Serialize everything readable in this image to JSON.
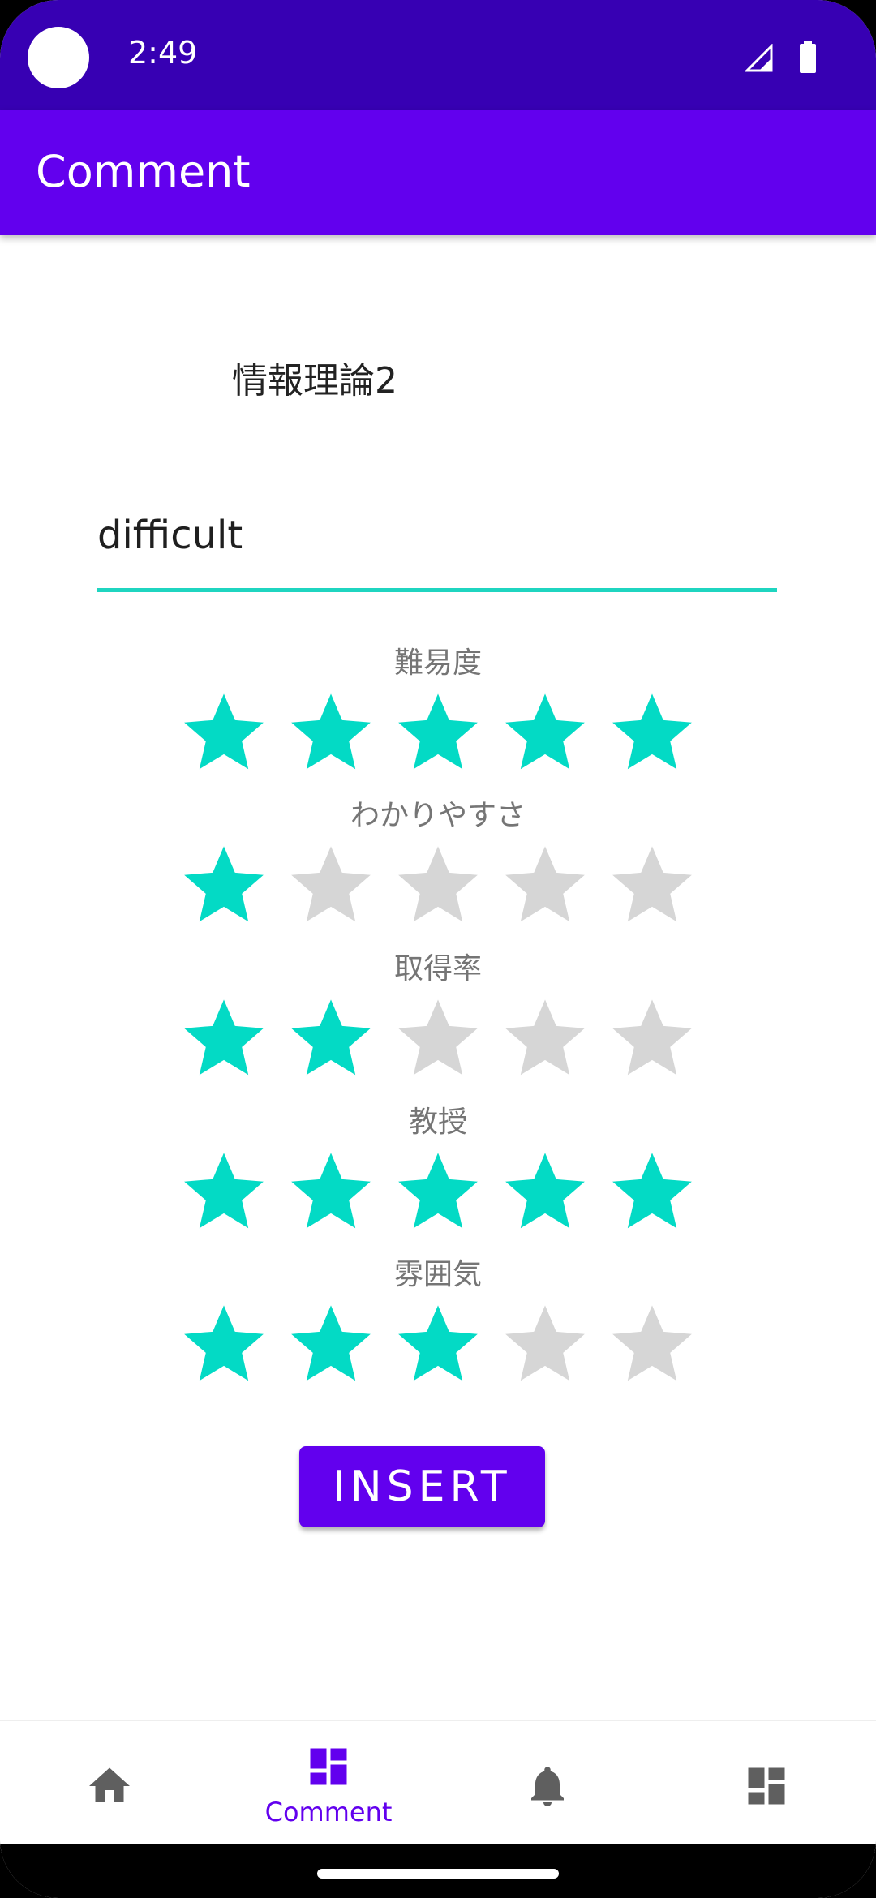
{
  "status_bar": {
    "time": "2:49",
    "icons": [
      "signal-icon",
      "battery-icon"
    ]
  },
  "app_bar": {
    "title": "Comment"
  },
  "course": {
    "name": "情報理論2"
  },
  "comment_input": {
    "value": "difficult"
  },
  "ratings": [
    {
      "label": "難易度",
      "value": 5,
      "max": 5
    },
    {
      "label": "わかりやすさ",
      "value": 1,
      "max": 5
    },
    {
      "label": "取得率",
      "value": 2,
      "max": 5
    },
    {
      "label": "教授",
      "value": 5,
      "max": 5
    },
    {
      "label": "雰囲気",
      "value": 3,
      "max": 5
    }
  ],
  "insert_button": {
    "label": "INSERT"
  },
  "bottom_nav": {
    "items": [
      {
        "icon": "home-icon",
        "label": ""
      },
      {
        "icon": "dashboard-icon",
        "label": "Comment",
        "active": true
      },
      {
        "icon": "bell-icon",
        "label": ""
      },
      {
        "icon": "dashboard-alt-icon",
        "label": ""
      }
    ]
  },
  "colors": {
    "status_bar": "#3700B3",
    "primary": "#6200EE",
    "star_filled": "#03DAC5",
    "star_empty": "#D6D6D6",
    "nav_inactive": "#5F5F5F"
  }
}
